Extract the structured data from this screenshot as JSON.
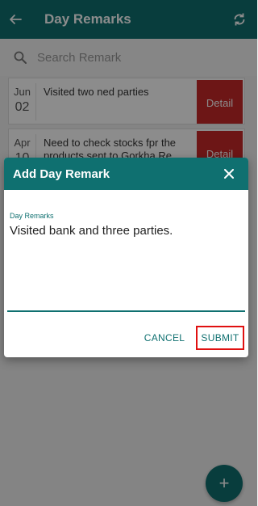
{
  "header": {
    "title": "Day Remarks",
    "back_icon": "arrow-left-icon",
    "sync_icon": "sync-icon"
  },
  "search": {
    "placeholder": "Search Remark",
    "icon": "search-icon"
  },
  "remarks": [
    {
      "month": "Jun",
      "day": "02",
      "text": "Visited two ned parties",
      "action": "Detail"
    },
    {
      "month": "Apr",
      "day": "10",
      "text": "Need to check stocks fpr the products sent to Gorkha Re",
      "action": "Detail"
    }
  ],
  "fab": {
    "label": "+"
  },
  "dialog": {
    "title": "Add Day Remark",
    "close_icon": "close-icon",
    "field_label": "Day Remarks",
    "field_value": "Visited bank and three parties.",
    "cancel_label": "CANCEL",
    "submit_label": "SUBMIT"
  },
  "colors": {
    "primary": "#0f7070",
    "detail": "#c62828",
    "highlight": "#e01010"
  }
}
